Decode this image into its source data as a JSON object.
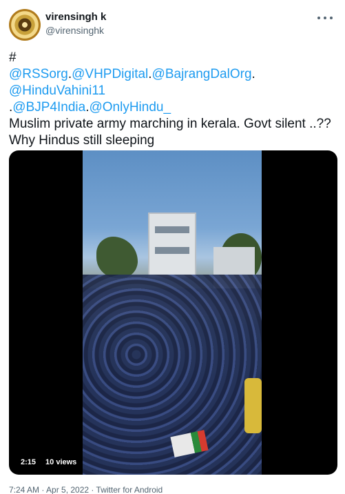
{
  "user": {
    "display_name": "virensingh k",
    "handle": "@virensinghk"
  },
  "tweet": {
    "line1": "#",
    "line2": [
      {
        "text": "@RSSorg",
        "mention": true
      },
      {
        "text": ".",
        "mention": false
      },
      {
        "text": "@VHPDigital",
        "mention": true
      },
      {
        "text": ".",
        "mention": false
      },
      {
        "text": "@BajrangDalOrg",
        "mention": true
      },
      {
        "text": ".",
        "mention": false
      }
    ],
    "line3_mention": "@HinduVahini11",
    "line4": [
      {
        "text": ".",
        "mention": false
      },
      {
        "text": "@BJP4India",
        "mention": true
      },
      {
        "text": ".",
        "mention": false
      },
      {
        "text": "@OnlyHindu_",
        "mention": true
      }
    ],
    "line5": "Muslim private army marching in kerala. Govt silent ..??",
    "line6": "Why Hindus still sleeping"
  },
  "video": {
    "duration": "2:15",
    "views": "10 views"
  },
  "footer": {
    "timestamp": "7:24 AM · Apr 5, 2022 · Twitter for Android"
  },
  "colors": {
    "mention": "#1d9bf0",
    "text": "#0f1419",
    "secondary": "#536471"
  }
}
